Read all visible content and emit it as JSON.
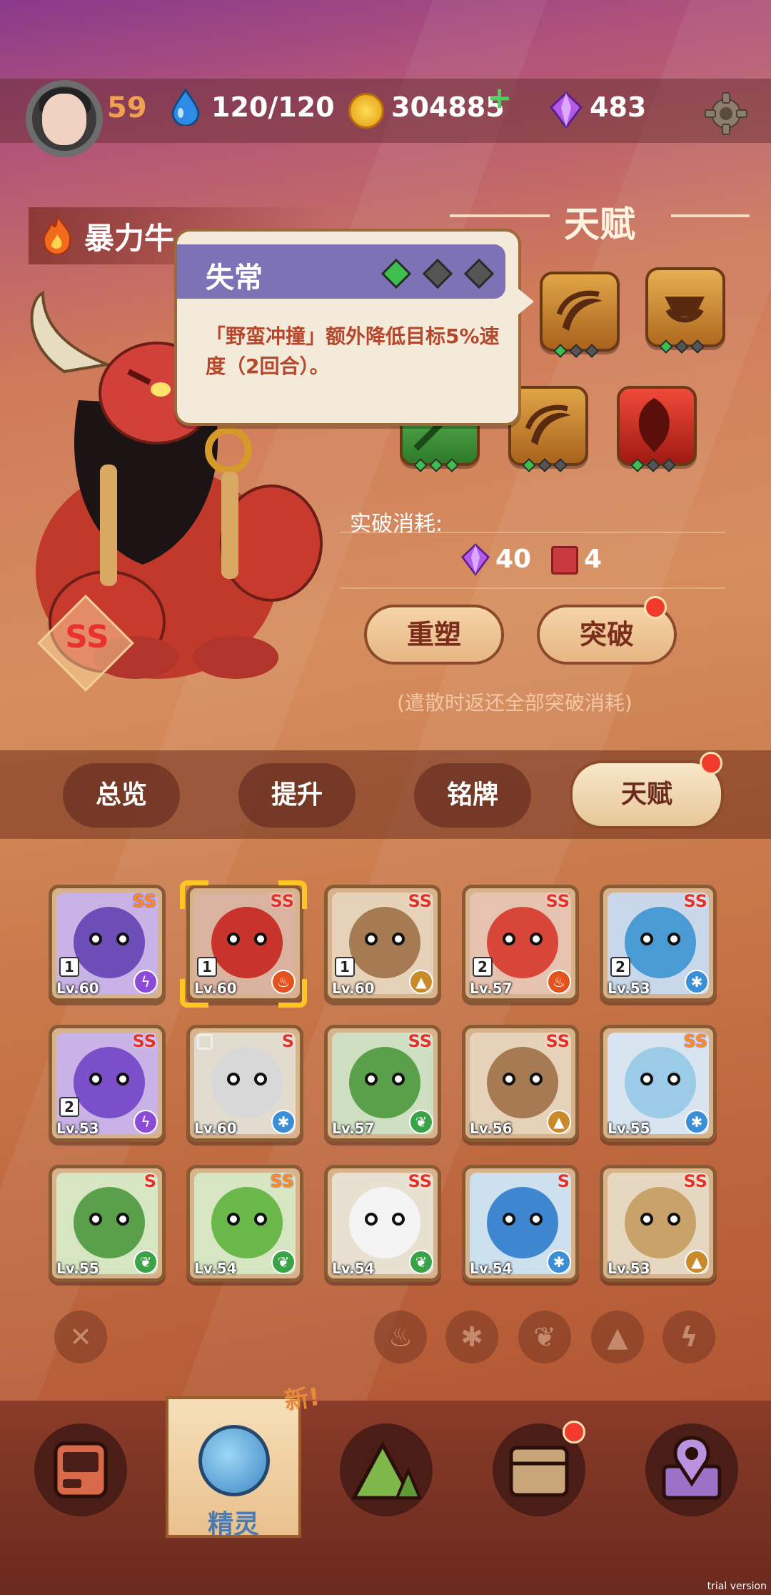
{
  "player": {
    "level": "59"
  },
  "resources": {
    "energy": "120/120",
    "coins": "304885",
    "coins_plus": "+",
    "gems": "483"
  },
  "monster": {
    "name": "暴力牛",
    "rank": "SS"
  },
  "talent": {
    "title": "天赋",
    "breakthrough_label": "实破消耗:",
    "cost_gems": "40",
    "cost_books": "4",
    "reshape_button": "重塑",
    "break_button": "突破",
    "note": "(遣散时返还全部突破消耗)"
  },
  "tooltip": {
    "title": "失常",
    "description": "「野蛮冲撞」额外降低目标5%速度（2回合）。"
  },
  "tabs": [
    {
      "label": "总览"
    },
    {
      "label": "提升"
    },
    {
      "label": "铭牌"
    },
    {
      "label": "天赋"
    }
  ],
  "roster": [
    {
      "level": "Lv.60",
      "rank": "SS",
      "count": "1",
      "element": "lightning"
    },
    {
      "level": "Lv.60",
      "rank": "SS",
      "count": "1",
      "element": "fire"
    },
    {
      "level": "Lv.60",
      "rank": "SS",
      "count": "1",
      "element": "earth"
    },
    {
      "level": "Lv.57",
      "rank": "SS",
      "count": "2",
      "element": "fire"
    },
    {
      "level": "Lv.53",
      "rank": "SS",
      "count": "2",
      "element": "ice"
    },
    {
      "level": "Lv.53",
      "rank": "SS",
      "count": "2",
      "element": "lightning"
    },
    {
      "level": "Lv.60",
      "rank": "S",
      "count": "",
      "element": "ice"
    },
    {
      "level": "Lv.57",
      "rank": "SS",
      "count": "",
      "element": "leaf"
    },
    {
      "level": "Lv.56",
      "rank": "SS",
      "count": "",
      "element": "earth"
    },
    {
      "level": "Lv.55",
      "rank": "SS",
      "count": "",
      "element": "ice"
    },
    {
      "level": "Lv.55",
      "rank": "S",
      "count": "",
      "element": "leaf"
    },
    {
      "level": "Lv.54",
      "rank": "SS",
      "count": "",
      "element": "leaf"
    },
    {
      "level": "Lv.54",
      "rank": "SS",
      "count": "",
      "element": "leaf"
    },
    {
      "level": "Lv.54",
      "rank": "S",
      "count": "",
      "element": "ice"
    },
    {
      "level": "Lv.53",
      "rank": "SS",
      "count": "",
      "element": "earth"
    }
  ],
  "filters": {
    "clear": "✕"
  },
  "nav": {
    "spirit_label": "精灵",
    "new_tag": "新!"
  },
  "watermark": "trial version",
  "colors": {
    "accent": "#f03a2c",
    "tooltip_header": "#7e72b6",
    "selection": "#ffc623"
  }
}
